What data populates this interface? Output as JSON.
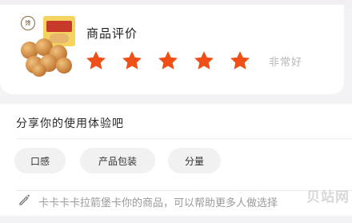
{
  "rating": {
    "title": "商品评价",
    "stars_filled": 5,
    "stars_total": 5,
    "star_color": "#ef4f16",
    "rating_text": "非常好",
    "product_brand_mark": "馋"
  },
  "share": {
    "title": "分享你的使用体验吧",
    "tags": [
      "口感",
      "产品包装",
      "分量"
    ],
    "review_text": "卡卡卡卡拉箭堡卡你的商品，可以帮助更多人做选择"
  },
  "watermark": "贝站网"
}
